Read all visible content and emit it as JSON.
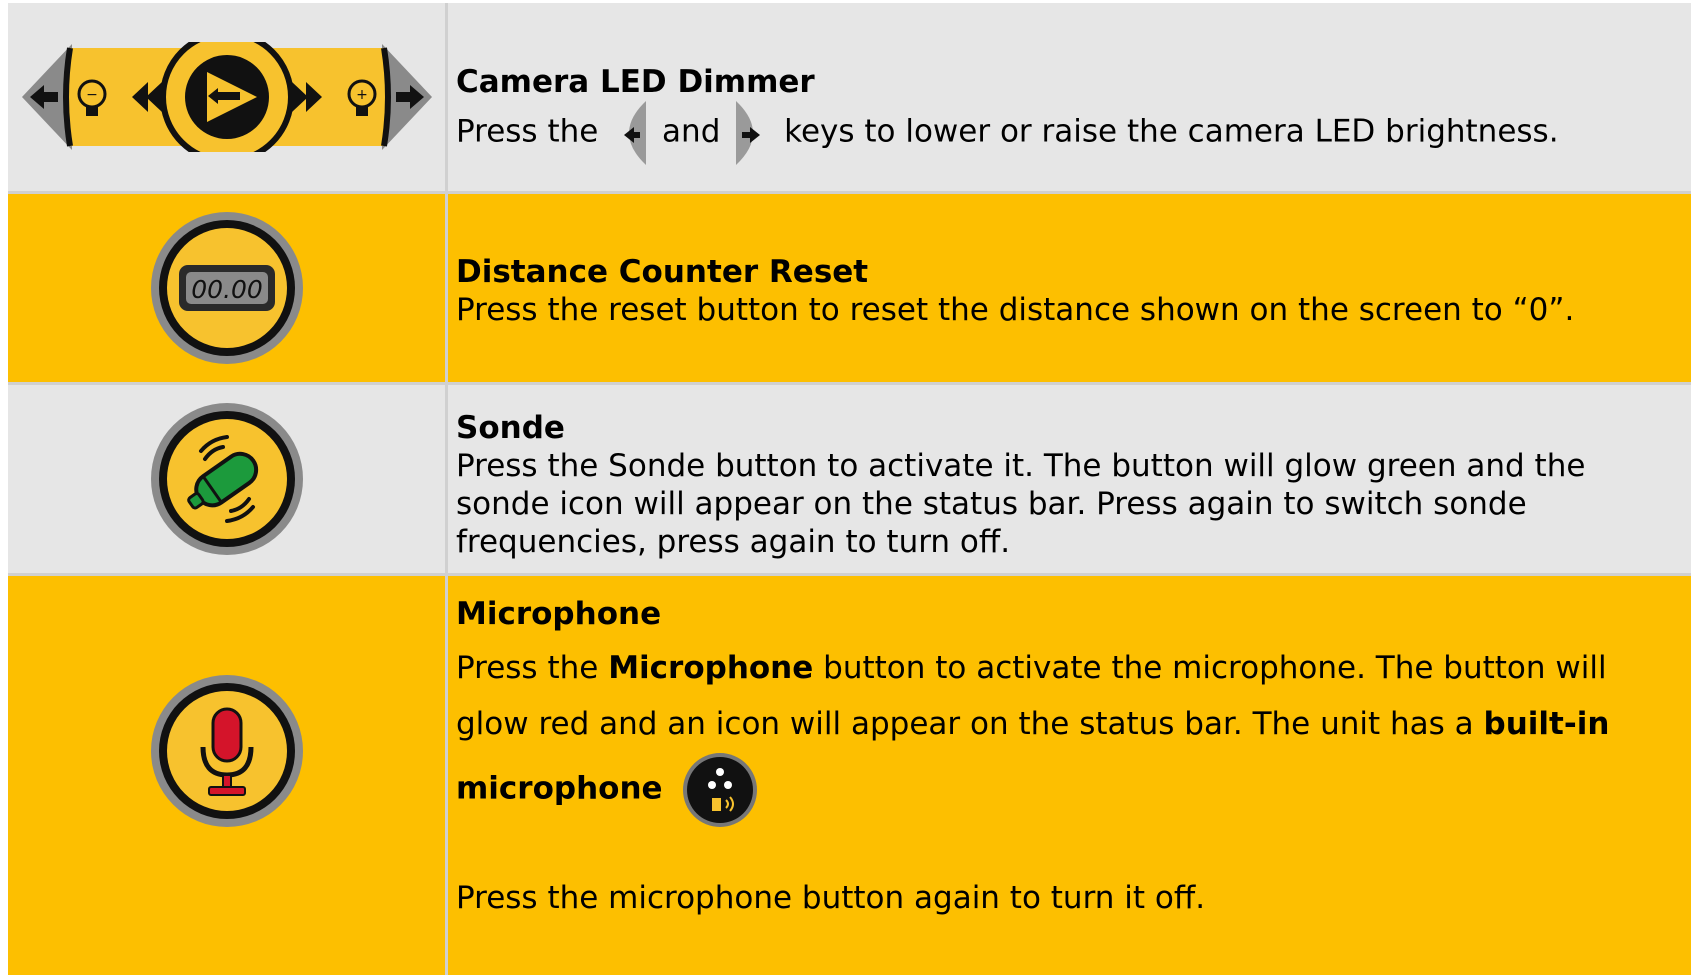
{
  "rows": [
    {
      "title": "Camera LED Dimmer",
      "text_before": "Press the",
      "text_middle": "and",
      "text_after": "keys to lower or raise the camera LED brightness.",
      "icon": "led-dimmer-dial-icon"
    },
    {
      "title": "Distance Counter Reset",
      "text": "Press the reset button to reset the distance shown on the screen to “0”.",
      "icon": "distance-counter-icon",
      "counter_display": "00.00"
    },
    {
      "title": "Sonde",
      "text": "Press the Sonde button to activate it. The button will glow green and the sonde icon will appear on the status bar. Press again to switch sonde frequencies, press again to turn off.",
      "icon": "sonde-icon"
    },
    {
      "title": "Microphone",
      "p1_before": "Press the",
      "p1_bold": "Microphone",
      "p1_after": "button to activate the microphone. The button will glow red and an icon will appear on the status bar. The unit has a",
      "p1_bold2": "built-in microphone",
      "p2": "Press the microphone button again to turn it off.",
      "icon": "microphone-icon"
    }
  ],
  "colors": {
    "yellow": "#fdbf00",
    "gray": "#e6e6e6",
    "sonde_green": "#1c9a3c",
    "mic_red": "#d4142a"
  }
}
